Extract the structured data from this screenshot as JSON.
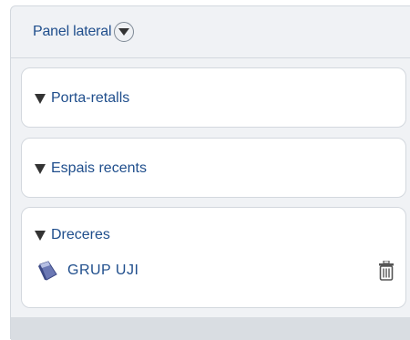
{
  "sidebar": {
    "title": "Panel lateral",
    "sections": [
      {
        "label": "Porta-retalls"
      },
      {
        "label": "Espais recents"
      },
      {
        "label": "Dreceres",
        "items": [
          {
            "label": "GRUP UJI"
          }
        ]
      }
    ]
  },
  "icons": {
    "toggle": "chevron-down-circle-icon",
    "expand": "triangle-down-icon",
    "space": "space-icon",
    "delete": "trash-icon"
  },
  "colors": {
    "link": "#1f4e8c",
    "panel_bg": "#f0f2f5",
    "border": "#d3d8de"
  }
}
